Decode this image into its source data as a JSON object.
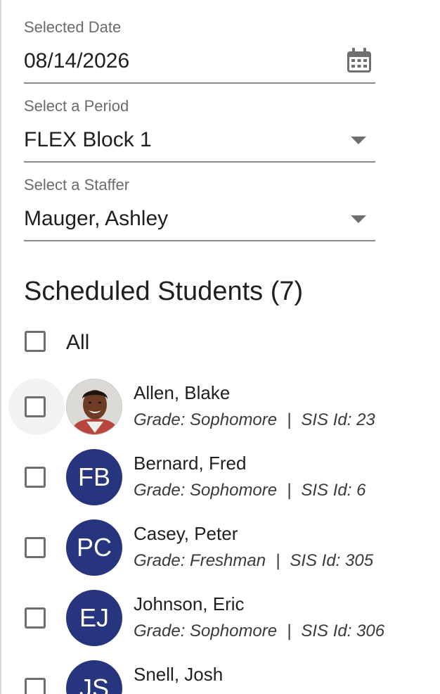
{
  "date_field": {
    "label": "Selected Date",
    "value": "08/14/2026",
    "icon": "calendar-icon"
  },
  "period_field": {
    "label": "Select a Period",
    "value": "FLEX Block 1",
    "icon": "dropdown-caret-icon"
  },
  "staffer_field": {
    "label": "Select a Staffer",
    "value": "Mauger, Ashley",
    "icon": "dropdown-caret-icon"
  },
  "scheduled": {
    "title": "Scheduled Students (7)",
    "all_label": "All"
  },
  "colors": {
    "avatar_bg": "#27357f",
    "checkbox_border": "#6e6e6e"
  },
  "students": [
    {
      "name": "Allen, Blake",
      "initials": "",
      "avatar": "photo",
      "grade": "Grade: Sophomore",
      "sep": "|",
      "sis": "SIS Id: 23"
    },
    {
      "name": "Bernard, Fred",
      "initials": "FB",
      "avatar": "initials",
      "grade": "Grade: Sophomore",
      "sep": "|",
      "sis": "SIS Id: 6"
    },
    {
      "name": "Casey, Peter",
      "initials": "PC",
      "avatar": "initials",
      "grade": "Grade: Freshman",
      "sep": "|",
      "sis": "SIS Id: 305"
    },
    {
      "name": "Johnson, Eric",
      "initials": "EJ",
      "avatar": "initials",
      "grade": "Grade: Sophomore",
      "sep": "|",
      "sis": "SIS Id: 306"
    },
    {
      "name": "Snell, Josh",
      "initials": "JS",
      "avatar": "initials",
      "grade": "",
      "sep": "",
      "sis": ""
    }
  ]
}
